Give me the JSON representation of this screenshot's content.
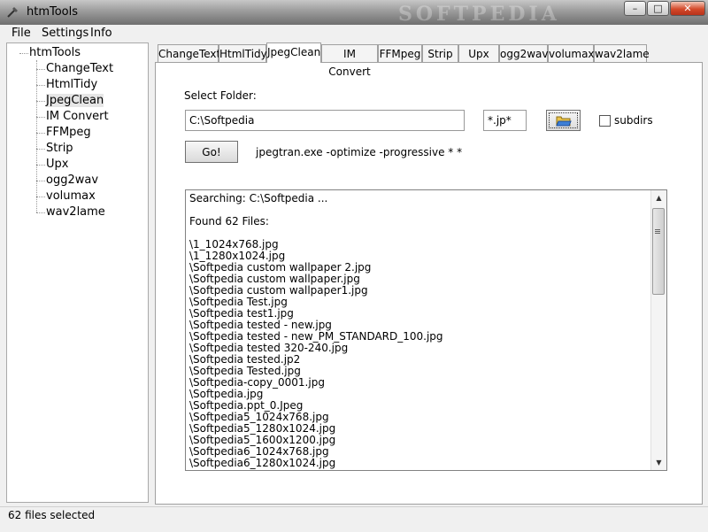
{
  "window": {
    "title": "htmTools",
    "minimize": "–",
    "maximize": "□",
    "close": "✕",
    "watermark": "SOFTPEDIA"
  },
  "menu": {
    "file": "File",
    "settings": "Settings",
    "info": "Info"
  },
  "tree": {
    "root": "htmTools",
    "items": [
      "ChangeText",
      "HtmlTidy",
      "JpegClean",
      "IM Convert",
      "FFMpeg",
      "Strip",
      "Upx",
      "ogg2wav",
      "volumax",
      "wav2lame"
    ],
    "selected": "JpegClean"
  },
  "tabs": [
    "ChangeText",
    "HtmlTidy",
    "JpegClean",
    "IM Convert",
    "FFMpeg",
    "Strip",
    "Upx",
    "ogg2wav",
    "volumax",
    "wav2lame"
  ],
  "active_tab": "JpegClean",
  "form": {
    "folder_label": "Select Folder:",
    "folder_value": "C:\\Softpedia",
    "filter_value": "*.jp*",
    "subdirs_label": "subdirs",
    "go_label": "Go!",
    "command": "jpegtran.exe -optimize -progressive * *"
  },
  "output": [
    "Searching: C:\\Softpedia ...",
    "",
    "Found 62 Files:",
    "",
    "\\1_1024x768.jpg",
    "\\1_1280x1024.jpg",
    "\\Softpedia custom wallpaper 2.jpg",
    "\\Softpedia custom wallpaper.jpg",
    "\\Softpedia custom wallpaper1.jpg",
    "\\Softpedia Test.jpg",
    "\\Softpedia test1.jpg",
    "\\Softpedia tested - new.jpg",
    "\\Softpedia tested - new_PM_STANDARD_100.jpg",
    "\\Softpedia tested 320-240.jpg",
    "\\Softpedia tested.jp2",
    "\\Softpedia Tested.jpg",
    "\\Softpedia-copy_0001.jpg",
    "\\Softpedia.jpg",
    "\\Softpedia.ppt_0.Jpeg",
    "\\Softpedia5_1024x768.jpg",
    "\\Softpedia5_1280x1024.jpg",
    "\\Softpedia5_1600x1200.jpg",
    "\\Softpedia6_1024x768.jpg",
    "\\Softpedia6_1280x1024.jpg"
  ],
  "status": "62 files selected"
}
